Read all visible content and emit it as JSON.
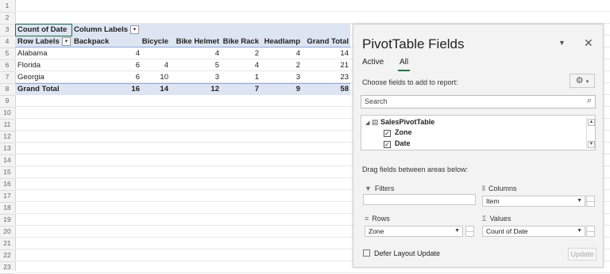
{
  "sheet": {
    "row_numbers": [
      "1",
      "2",
      "3",
      "4",
      "5",
      "6",
      "7",
      "8",
      "9",
      "10",
      "11",
      "12",
      "13",
      "14",
      "15",
      "16",
      "17",
      "18",
      "19",
      "20",
      "21",
      "22",
      "23"
    ],
    "pivot": {
      "count_label": "Count of Date",
      "column_labels": "Column Labels",
      "row_labels": "Row Labels",
      "headers": [
        "Backpack",
        "Bicycle",
        "Bike Helmet",
        "Bike Rack",
        "Headlamp",
        "Grand Total"
      ],
      "rows": [
        {
          "label": "Alabama",
          "values": [
            "4",
            "",
            "4",
            "2",
            "4",
            "14"
          ]
        },
        {
          "label": "Florida",
          "values": [
            "6",
            "4",
            "5",
            "4",
            "2",
            "21"
          ]
        },
        {
          "label": "Georgia",
          "values": [
            "6",
            "10",
            "3",
            "1",
            "3",
            "23"
          ]
        }
      ],
      "total": {
        "label": "Grand Total",
        "values": [
          "16",
          "14",
          "12",
          "7",
          "9",
          "58"
        ]
      }
    }
  },
  "panel": {
    "title": "PivotTable Fields",
    "tabs": [
      "Active",
      "All"
    ],
    "choose_label": "Choose fields to add to report:",
    "search_placeholder": "Search",
    "table_name": "SalesPivotTable",
    "fields": [
      "Zone",
      "Date"
    ],
    "drag_label": "Drag fields between areas below:",
    "areas": {
      "filters": {
        "label": "Filters"
      },
      "columns": {
        "label": "Columns",
        "value": "Item"
      },
      "rows": {
        "label": "Rows",
        "value": "Zone"
      },
      "values": {
        "label": "Values",
        "value": "Count of Date"
      }
    },
    "defer_label": "Defer Layout Update",
    "update_label": "Update"
  }
}
